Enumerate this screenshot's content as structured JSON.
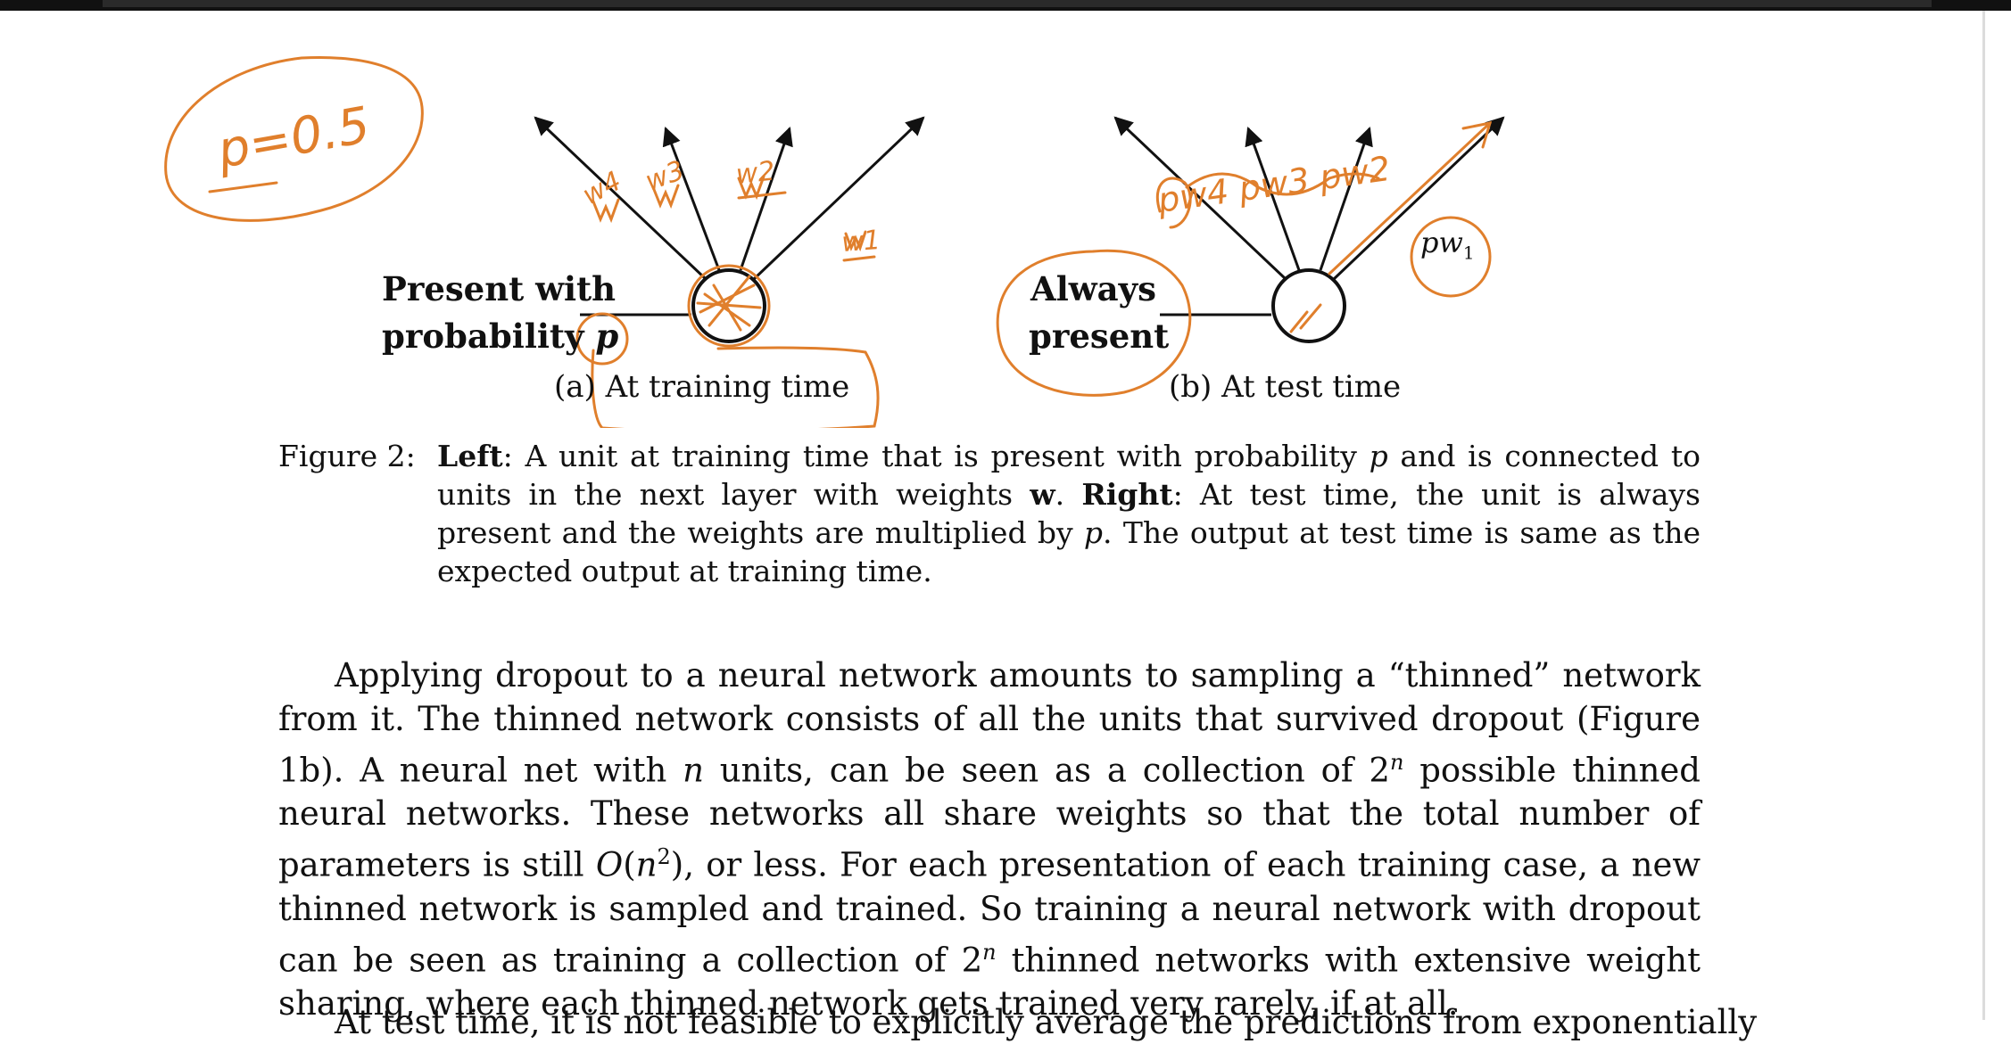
{
  "colors": {
    "ink": "#111111",
    "annotation": "#e07f2c",
    "topbar": "#111111"
  },
  "figure": {
    "left_label_line1": "Present with",
    "left_label_line2": "probability",
    "left_label_var": "p",
    "left_subcaption": "(a) At training time",
    "right_label_line1": "Always",
    "right_label_line2": "present",
    "right_subcaption": "(b) At test time",
    "right_weight_label": "pw",
    "right_weight_sub": "1"
  },
  "annotations": {
    "p_note": "p=0.5",
    "left_weights": [
      "w4",
      "w3",
      "w2",
      "w1"
    ],
    "right_weights": "pw4 pw3 pw2"
  },
  "caption": {
    "label": "Figure 2:",
    "left_head": "Left",
    "text1": ": A unit at training time that is present with probability ",
    "var_p1": "p",
    "text2": " and is connected to units in the next layer with weights ",
    "bold_w": "w",
    "text3": ". ",
    "right_head": "Right",
    "text4": ": At test time, the unit is always present and the weights are multiplied by ",
    "var_p2": "p",
    "text5": ". The output at test time is same as the expected output at training time."
  },
  "body": {
    "s1": "Applying dropout to a neural network amounts to sampling a “thinned” network from it. The thinned network consists of all the units that survived dropout (Figure 1b). A neural net with ",
    "var_n1": "n",
    "s2": " units, can be seen as a collection of 2",
    "sup_n1": "n",
    "s3": " possible thinned neural networks. These networks all share weights so that the total number of parameters is still ",
    "o_big": "O",
    "o_open": "(",
    "var_n2": "n",
    "sup_2": "2",
    "o_close": ")",
    "s4": ", or less. For each presentation of each training case, a new thinned network is sampled and trained. So training a neural network with dropout can be seen as training a collection of 2",
    "sup_n2": "n",
    "s5": " thinned networks with extensive weight sharing, where each thinned network gets trained very rarely, if at all.",
    "cut_line": "At test time, it is not feasible to explicitly average the predictions from exponentially"
  }
}
